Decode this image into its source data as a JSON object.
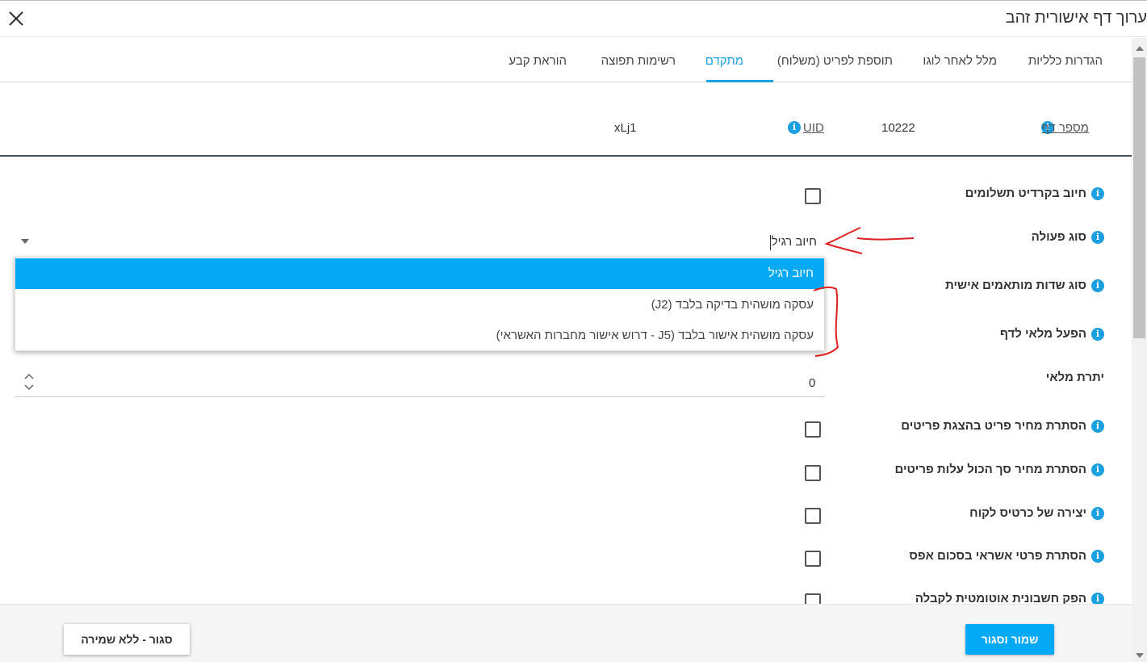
{
  "header": {
    "title": "ערוך דף אישורית זהב"
  },
  "tabs": [
    {
      "label": "הגדרות כלליות"
    },
    {
      "label": "מלל לאחר לוגו"
    },
    {
      "label": "תוספת לפריט (משלוח)"
    },
    {
      "label": "מתקדם"
    },
    {
      "label": "רשימות תפוצה"
    },
    {
      "label": "הוראת קבע"
    }
  ],
  "active_tab": "מתקדם",
  "meta": {
    "page_number_label": "מספר דף",
    "page_number_value": "10222",
    "uid_label": "UID",
    "uid_value": "xLj1"
  },
  "form": {
    "credit_payments_label": "חיוב בקרדיט תשלומים",
    "action_type_label": "סוג פעולה",
    "action_type_value": "חיוב רגיל",
    "action_type_options": [
      "חיוב רגיל",
      "עסקה מושהית בדיקה בלבד (J2)",
      "עסקה מושהית אישור בלבד (J5 - דרוש אישור מחברות האשראי)"
    ],
    "custom_fields_label": "סוג שדות מותאמים אישית",
    "page_fill_label": "הפעל מלאי לדף",
    "stock_remaining_label": "יתרת מלאי",
    "stock_remaining_value": "0",
    "hide_item_price_label": "הסתרת מחיר פריט בהצגת פריטים",
    "hide_total_price_label": "הסתרת מחיר סך הכול עלות פריטים",
    "create_customer_card_label": "יצירה של כרטיס לקוח",
    "hide_credit_zero_label": "הסתרת פרטי אשראי בסכום אפס",
    "auto_invoice_label": "הפק חשבונית אוטומטית לקבלה"
  },
  "footer": {
    "save_label": "שמור וסגור",
    "close_label": "סגור - ללא שמירה"
  },
  "icons": {
    "close": "close-icon",
    "info": "info-icon"
  },
  "colors": {
    "accent": "#03a9f4",
    "annotation": "#e02020"
  }
}
